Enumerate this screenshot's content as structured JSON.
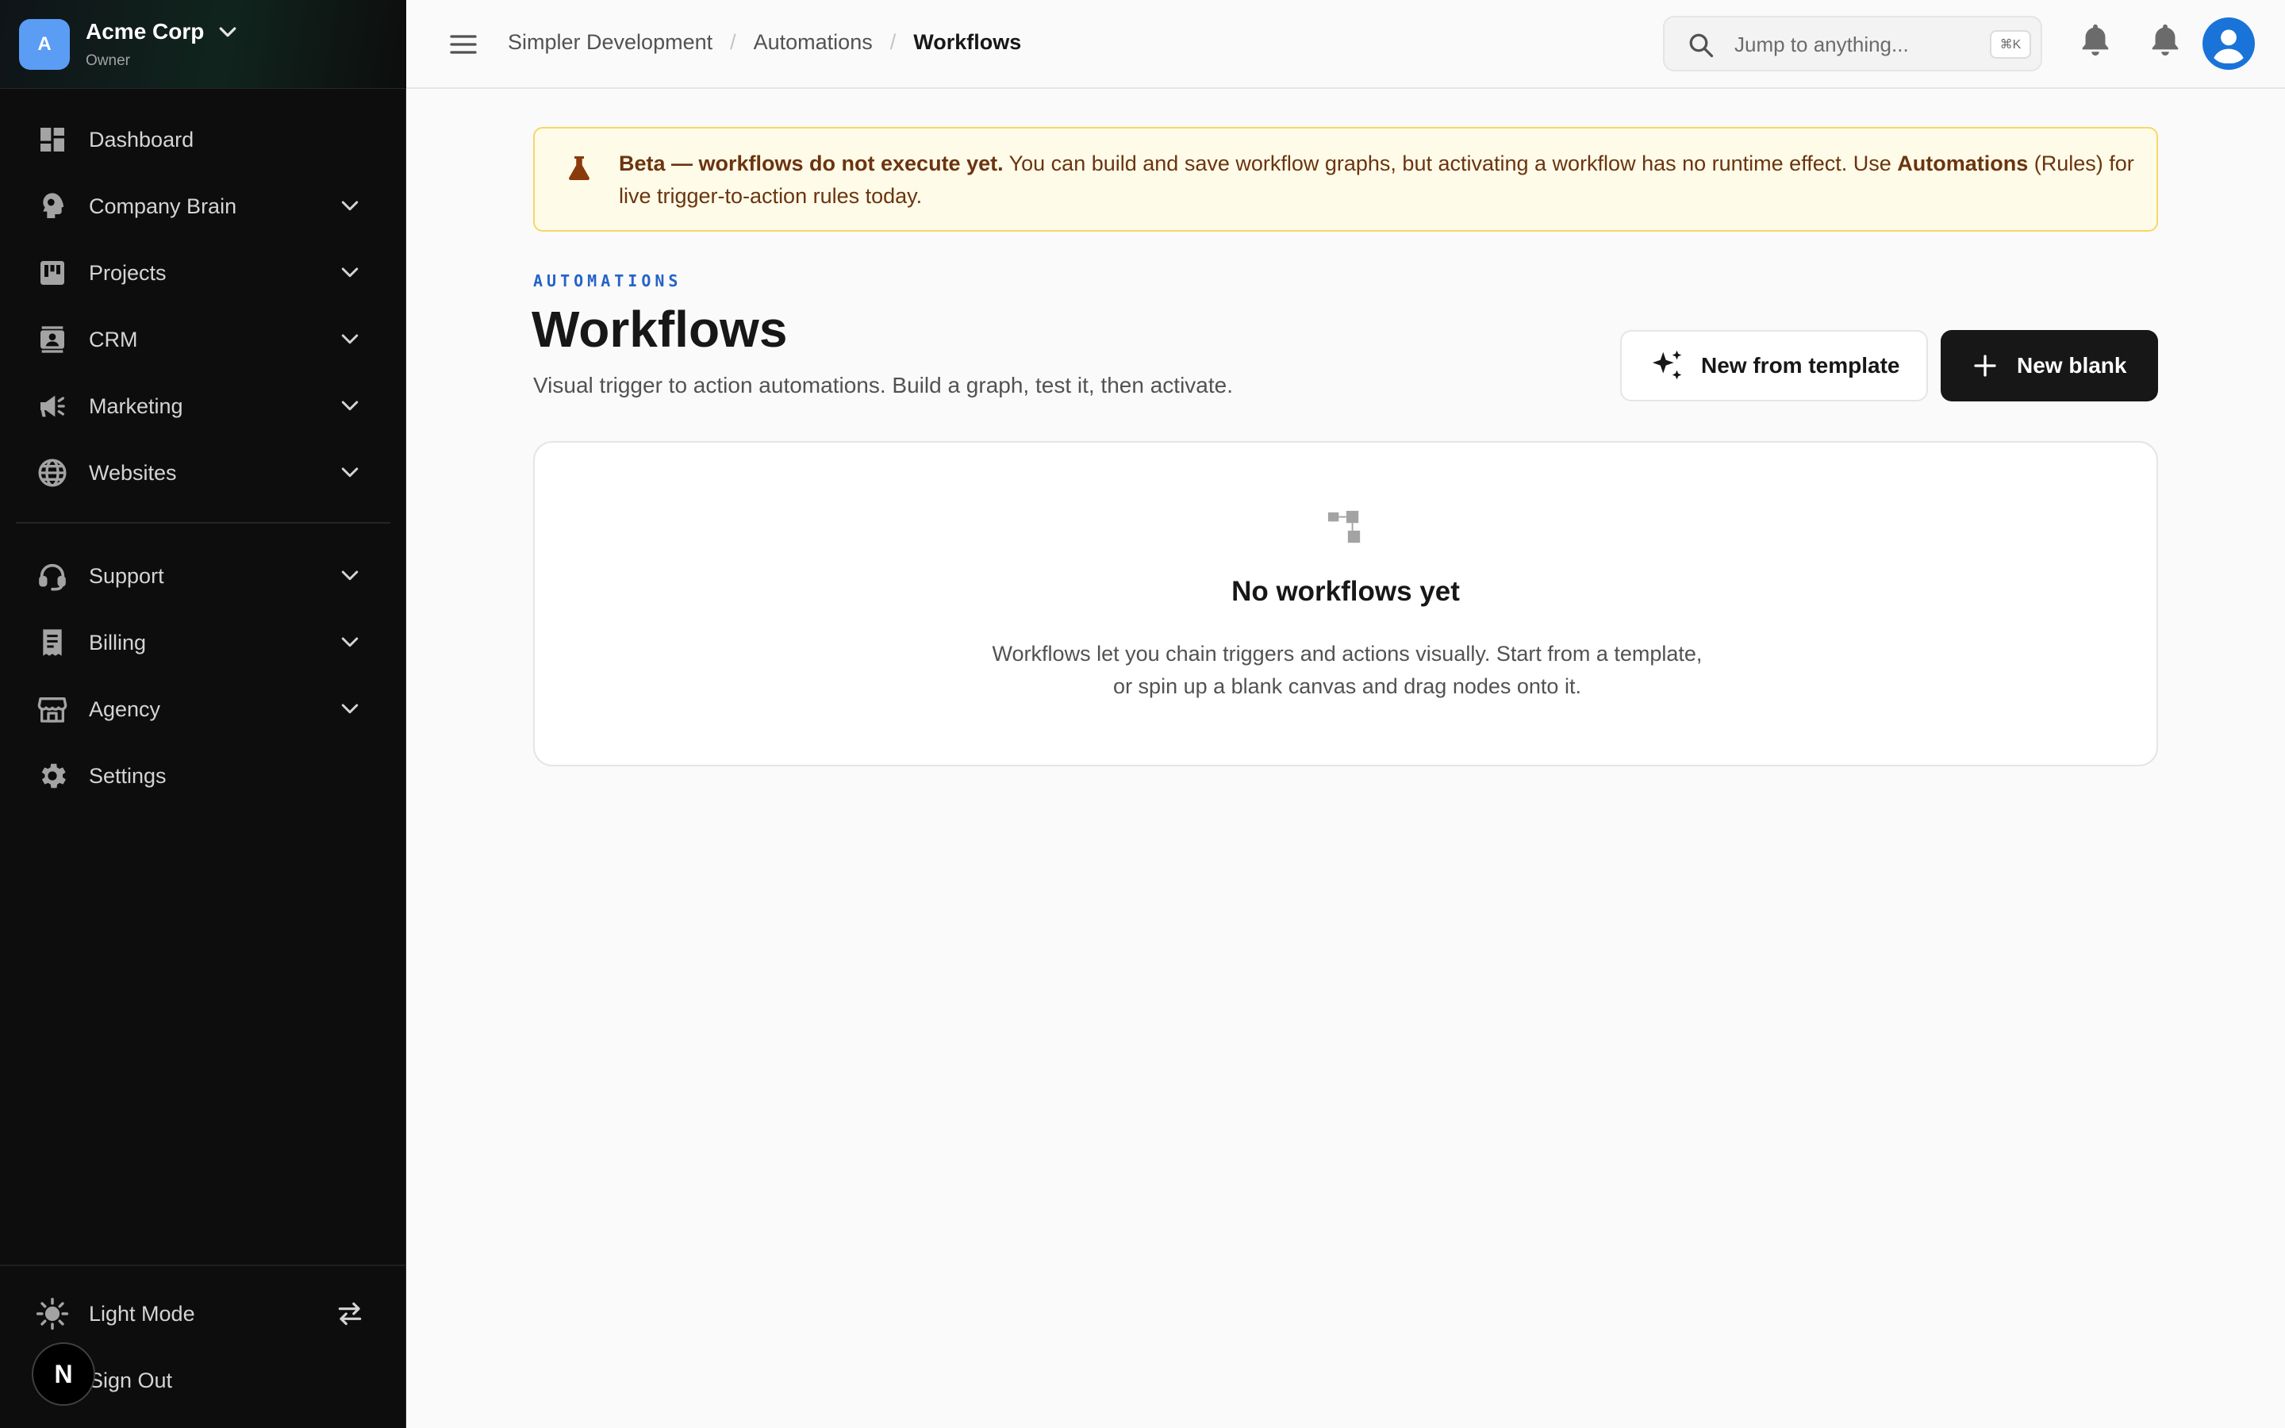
{
  "org": {
    "initial": "A",
    "name": "Acme Corp",
    "role": "Owner"
  },
  "nav": {
    "dashboard": "Dashboard",
    "company_brain": "Company Brain",
    "projects": "Projects",
    "crm": "CRM",
    "marketing": "Marketing",
    "websites": "Websites",
    "support": "Support",
    "billing": "Billing",
    "agency": "Agency",
    "settings": "Settings",
    "light_mode": "Light Mode",
    "sign_out": "Sign Out"
  },
  "n_badge": "N",
  "breadcrumb": [
    "Simpler Development",
    "Automations",
    "Workflows"
  ],
  "breadcrumb_separator": "/",
  "search": {
    "placeholder": "Jump to anything...",
    "shortcut": "⌘K"
  },
  "banner": {
    "lead": "Beta — workflows do not execute yet.",
    "body": " You can build and save workflow graphs, but activating a workflow has no runtime effect. Use ",
    "link": "Automations",
    "tail": " (Rules) for live trigger-to-action rules today."
  },
  "page": {
    "eyebrow": "AUTOMATIONS",
    "title": "Workflows",
    "subtitle": "Visual trigger to action automations. Build a graph, test it, then activate."
  },
  "actions": {
    "new_from_template": "New from template",
    "new_blank": "New blank"
  },
  "empty_state": {
    "title": "No workflows yet",
    "description": "Workflows let you chain triggers and actions visually. Start from a template, or spin up a blank canvas and drag nodes onto it."
  },
  "colors": {
    "sidebar_bg": "#0d0d0d",
    "accent_blue": "#2563c9",
    "banner_bg": "#fefbe8",
    "banner_border": "#f5d867",
    "banner_text": "#6b3410",
    "primary_button": "#171717",
    "org_avatar": "#5b9cf5",
    "user_avatar": "#1a73d9"
  },
  "icons": {
    "dashboard": "dashboard-icon",
    "company_brain": "brain-icon",
    "projects": "kanban-icon",
    "crm": "contact-card-icon",
    "marketing": "megaphone-icon",
    "websites": "globe-icon",
    "support": "headset-icon",
    "billing": "receipt-icon",
    "agency": "storefront-icon",
    "settings": "gear-icon",
    "light_mode": "sun-icon",
    "toggle": "swap-arrows-icon",
    "banner": "flask-icon",
    "template": "sparkles-icon",
    "blank": "plus-icon",
    "empty": "workflow-tree-icon"
  }
}
